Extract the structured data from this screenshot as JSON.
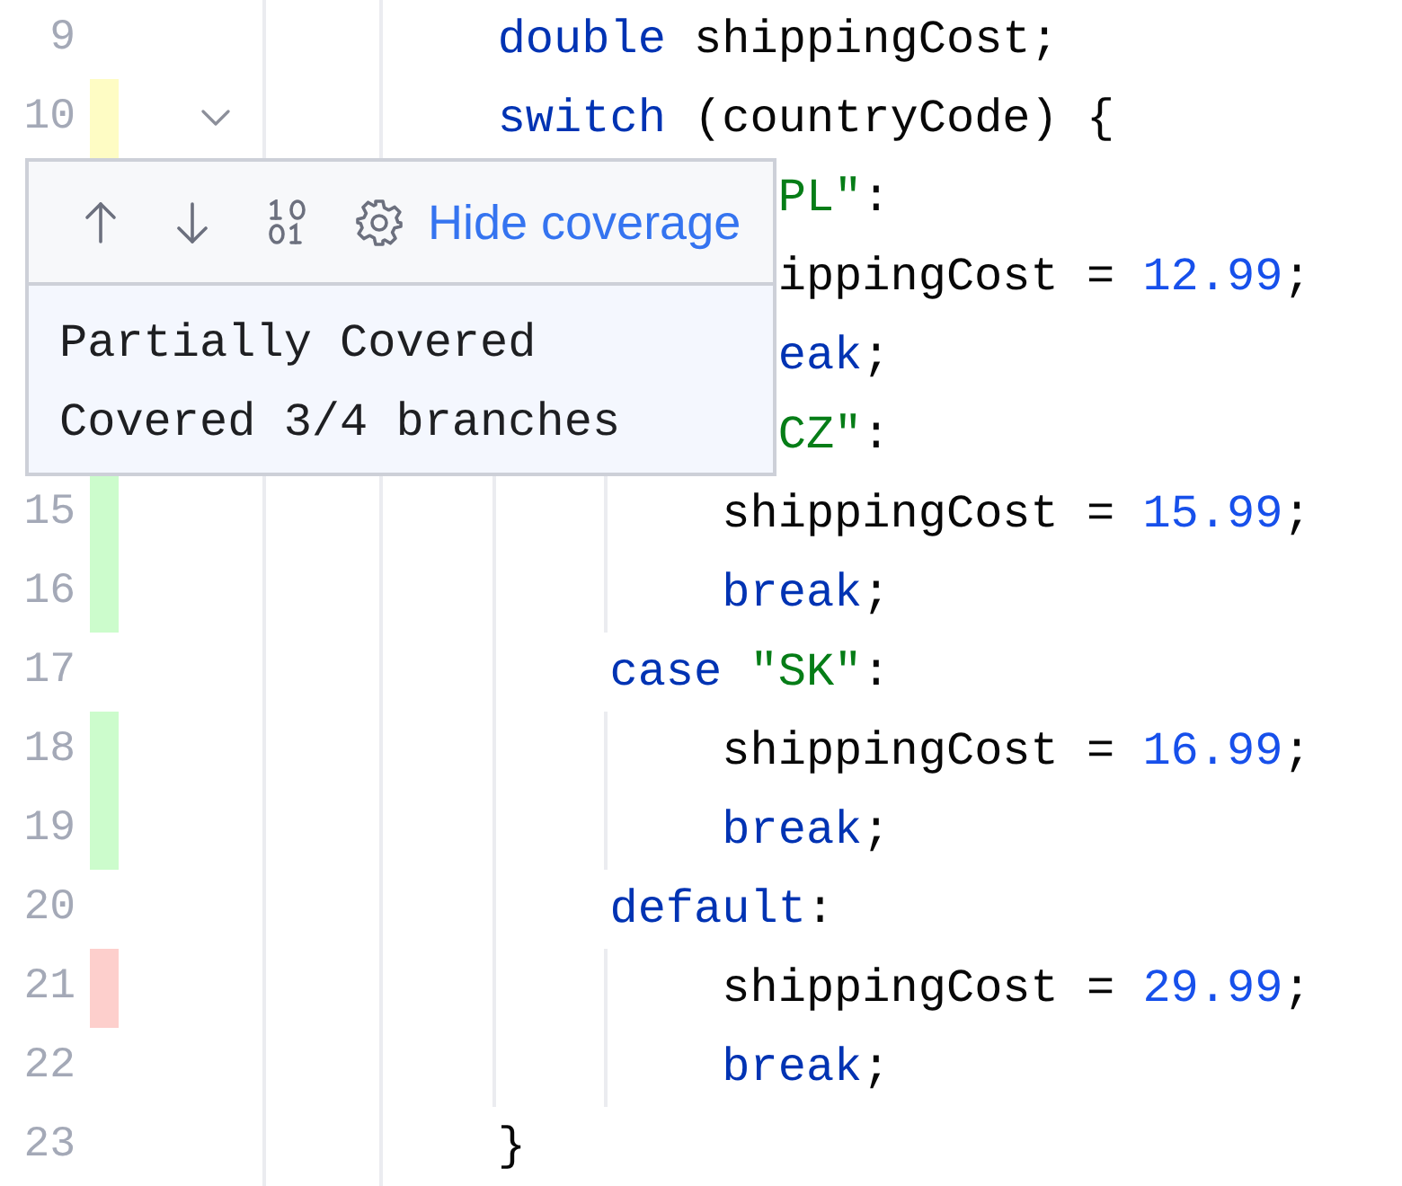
{
  "editor": {
    "code": [
      {
        "number": "9",
        "tokens": [
          {
            "kind": "keyword",
            "text": "double"
          },
          {
            "kind": "plain",
            "text": " shippingCost;"
          }
        ]
      },
      {
        "number": "10",
        "color": "#fefcc4",
        "expanded": true,
        "tokens": [
          {
            "kind": "keyword",
            "text": "switch"
          },
          {
            "kind": "plain",
            "text": " (countryCode) {"
          }
        ],
        "children": [
          {
            "behind_popup": true,
            "tokens": [
              {
                "kind": "string",
                "text": "PL\""
              },
              {
                "kind": "plain",
                "text": ":"
              }
            ],
            "children": [
              {
                "behind_popup": true,
                "tokens": [
                  {
                    "kind": "plain",
                    "text": "ippingCost = "
                  },
                  {
                    "kind": "number",
                    "text": "12.99"
                  },
                  {
                    "kind": "plain",
                    "text": ";"
                  }
                ]
              },
              {
                "behind_popup": true,
                "tokens": [
                  {
                    "kind": "keyword",
                    "text": "eak"
                  },
                  {
                    "kind": "plain",
                    "text": ";"
                  }
                ]
              }
            ]
          },
          {
            "behind_popup": true,
            "tokens": [
              {
                "kind": "string",
                "text": "CZ\""
              },
              {
                "kind": "plain",
                "text": ":"
              }
            ],
            "children": [
              {
                "number": "15",
                "color": "#ccfccc",
                "tokens": [
                  {
                    "kind": "plain",
                    "text": "shippingCost = "
                  },
                  {
                    "kind": "number",
                    "text": "15.99"
                  },
                  {
                    "kind": "plain",
                    "text": ";"
                  }
                ]
              },
              {
                "number": "16",
                "color": "#ccfccc",
                "tokens": [
                  {
                    "kind": "keyword",
                    "text": "break"
                  },
                  {
                    "kind": "plain",
                    "text": ";"
                  }
                ]
              }
            ]
          },
          {
            "number": "17",
            "tokens": [
              {
                "kind": "keyword",
                "text": "case"
              },
              {
                "kind": "string",
                "text": " \"SK\""
              },
              {
                "kind": "plain",
                "text": ":"
              }
            ],
            "children": [
              {
                "number": "18",
                "color": "#ccfccc",
                "tokens": [
                  {
                    "kind": "plain",
                    "text": "shippingCost = "
                  },
                  {
                    "kind": "number",
                    "text": "16.99"
                  },
                  {
                    "kind": "plain",
                    "text": ";"
                  }
                ]
              },
              {
                "number": "19",
                "color": "#ccfccc",
                "tokens": [
                  {
                    "kind": "keyword",
                    "text": "break"
                  },
                  {
                    "kind": "plain",
                    "text": ";"
                  }
                ]
              }
            ]
          },
          {
            "number": "20",
            "tokens": [
              {
                "kind": "keyword",
                "text": "default"
              },
              {
                "kind": "plain",
                "text": ":"
              }
            ],
            "children": [
              {
                "number": "21",
                "color": "#fdcfcc",
                "tokens": [
                  {
                    "kind": "plain",
                    "text": "shippingCost = "
                  },
                  {
                    "kind": "number",
                    "text": "29.99"
                  },
                  {
                    "kind": "plain",
                    "text": ";"
                  }
                ]
              },
              {
                "number": "22",
                "tokens": [
                  {
                    "kind": "keyword",
                    "text": "break"
                  },
                  {
                    "kind": "plain",
                    "text": ";"
                  }
                ]
              }
            ]
          }
        ]
      },
      {
        "number": "23",
        "tokens": [
          {
            "kind": "plain",
            "text": "}"
          }
        ]
      }
    ]
  },
  "coverage_popup": {
    "link": "Hide coverage",
    "messages": [
      "Partially Covered",
      "Covered 3/4 branches"
    ]
  }
}
